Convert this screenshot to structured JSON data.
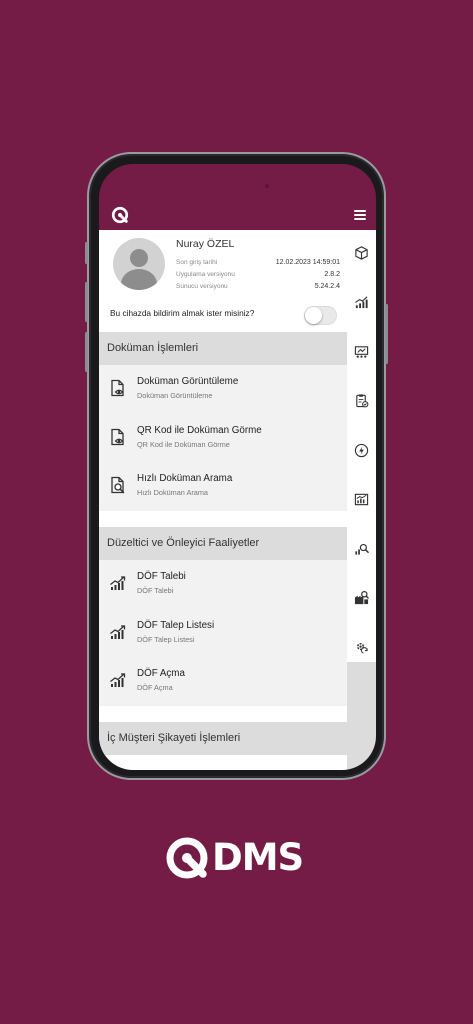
{
  "colors": {
    "background": "#741c46",
    "section_header": "#dcdcdc",
    "menu_bg": "#f2f2f2",
    "icon": "#333333"
  },
  "profile": {
    "name": "Nuray ÖZEL",
    "last_login_label": "Son giriş tarihi",
    "last_login_value": "12.02.2023 14:59:01",
    "app_version_label": "Uygulama versiyonu",
    "app_version_value": "2.8.2",
    "server_version_label": "Sunucu versiyonu",
    "server_version_value": "5.24.2.4"
  },
  "notification": {
    "label": "Bu cihazda bildirim almak ister misiniz?",
    "enabled": false
  },
  "sections": [
    {
      "title": "Doküman İşlemleri",
      "items": [
        {
          "title": "Doküman Görüntüleme",
          "subtitle": "Doküman Görüntüleme",
          "icon": "document-view-icon"
        },
        {
          "title": "QR Kod ile Doküman Görme",
          "subtitle": "QR Kod ile Doküman Görme",
          "icon": "document-qr-icon"
        },
        {
          "title": "Hızlı Doküman Arama",
          "subtitle": "Hızlı Doküman Arama",
          "icon": "document-search-icon"
        }
      ]
    },
    {
      "title": "Düzeltici ve Önleyici Faaliyetler",
      "items": [
        {
          "title": "DÖF Talebi",
          "subtitle": "DÖF Talebi",
          "icon": "chart-up-icon"
        },
        {
          "title": "DÖF Talep Listesi",
          "subtitle": "DÖF Talep Listesi",
          "icon": "chart-up-icon"
        },
        {
          "title": "DÖF Açma",
          "subtitle": "DÖF Açma",
          "icon": "chart-up-icon"
        }
      ]
    },
    {
      "title": "İç Müşteri Şikayeti İşlemleri",
      "items": []
    }
  ],
  "rail_icons": [
    "box-icon",
    "chart-up-icon",
    "presentation-icon",
    "clipboard-check-icon",
    "lightning-icon",
    "chart-board-icon",
    "chart-search-icon",
    "factory-search-icon",
    "gear-refresh-icon"
  ],
  "brand": {
    "text": "DMS"
  }
}
